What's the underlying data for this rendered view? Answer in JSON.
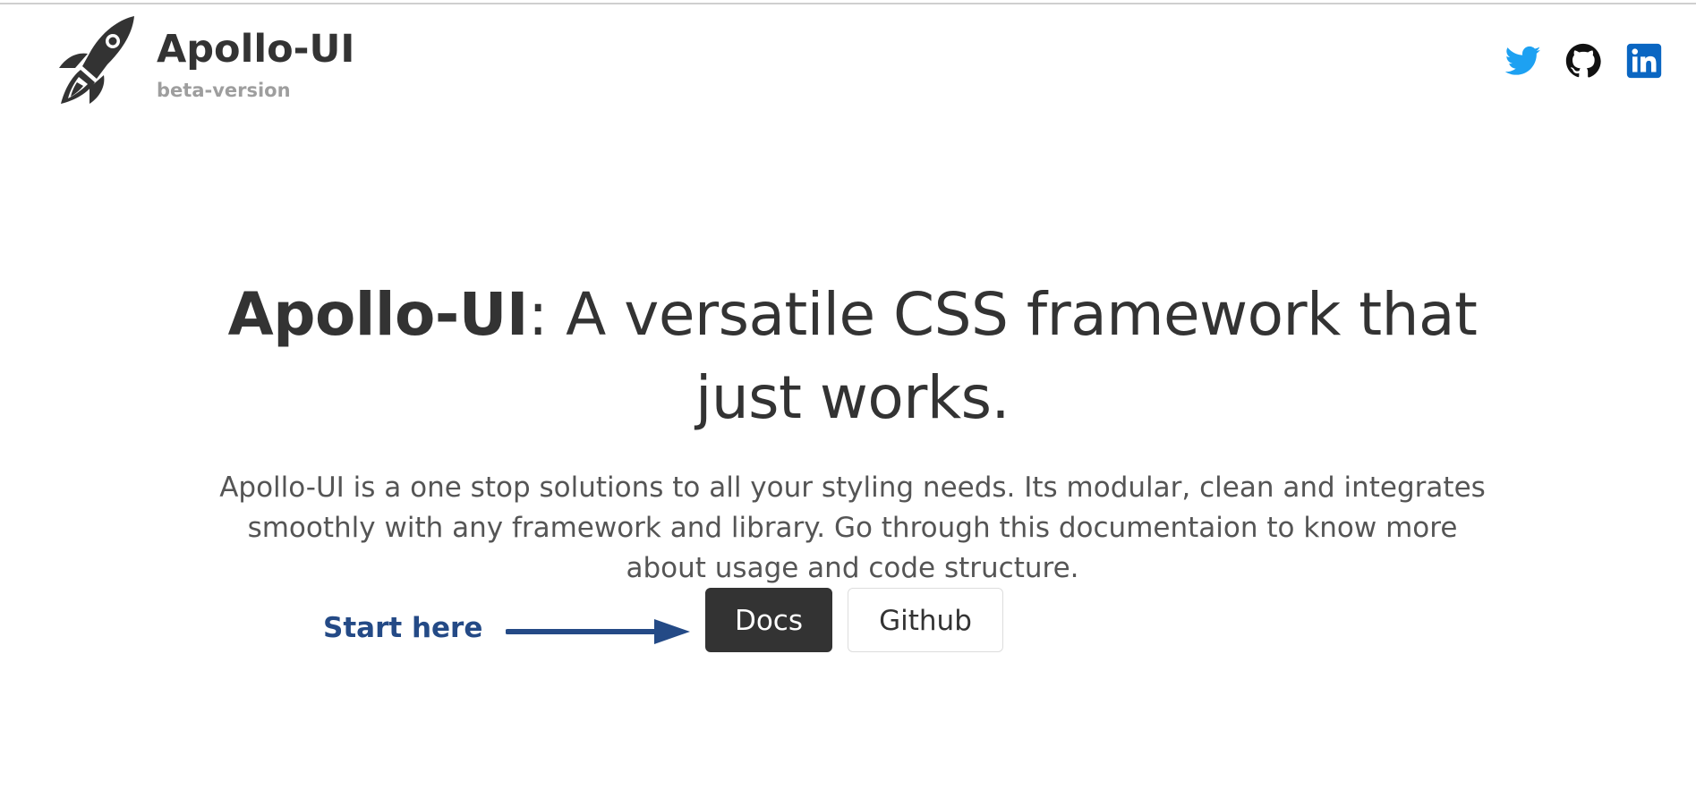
{
  "header": {
    "title": "Apollo-UI",
    "subtitle": "beta-version",
    "logo_icon": "rocket-icon",
    "social": [
      {
        "name": "twitter",
        "icon": "twitter-icon",
        "color": "#1da1f2"
      },
      {
        "name": "github",
        "icon": "github-icon",
        "color": "#111111"
      },
      {
        "name": "linkedin",
        "icon": "linkedin-icon",
        "color": "#0a66c2"
      }
    ]
  },
  "hero": {
    "title_strong": "Apollo-UI",
    "title_rest": ": A versatile CSS framework that just works.",
    "description": "Apollo-UI is a one stop solutions to all your styling needs. Its modular, clean and integrates smoothly with any framework and library. Go through this documentaion to know more about usage and code structure."
  },
  "buttons": {
    "docs_label": "Docs",
    "github_label": "Github"
  },
  "annotation": {
    "text": "Start here",
    "color": "#244a86"
  },
  "colors": {
    "primary_dark": "#333333",
    "muted": "#9e9e9e",
    "annotation": "#244a86"
  }
}
